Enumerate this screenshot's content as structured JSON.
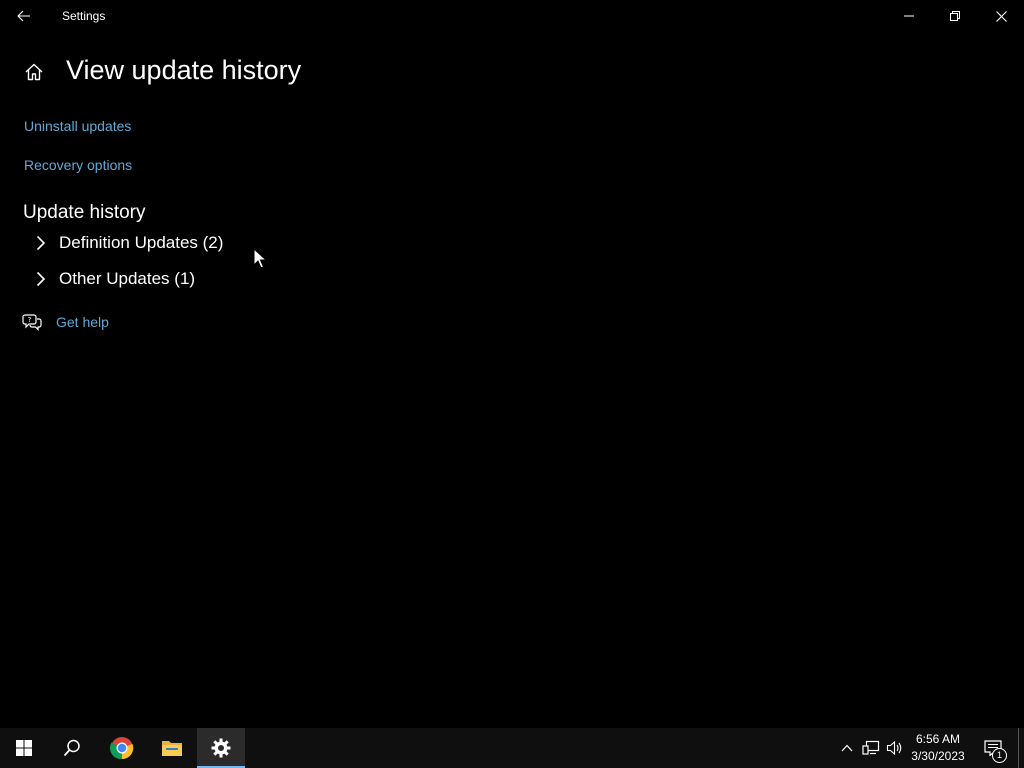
{
  "window": {
    "title": "Settings"
  },
  "header": {
    "title": "View update history"
  },
  "links": {
    "uninstall": "Uninstall updates",
    "recovery": "Recovery options",
    "help": "Get help"
  },
  "section": {
    "title": "Update history",
    "groups": [
      {
        "label": "Definition Updates (2)"
      },
      {
        "label": "Other Updates (1)"
      }
    ]
  },
  "taskbar": {
    "time": "6:56 AM",
    "date": "3/30/2023",
    "notification_count": "1",
    "apps": [
      "start-icon",
      "search-icon",
      "chrome-icon",
      "file-explorer-icon",
      "settings-icon"
    ]
  },
  "colors": {
    "background": "#000000",
    "link": "#5fa9d6",
    "taskbar": "#0f0f10",
    "accent": "#76b9ed"
  }
}
